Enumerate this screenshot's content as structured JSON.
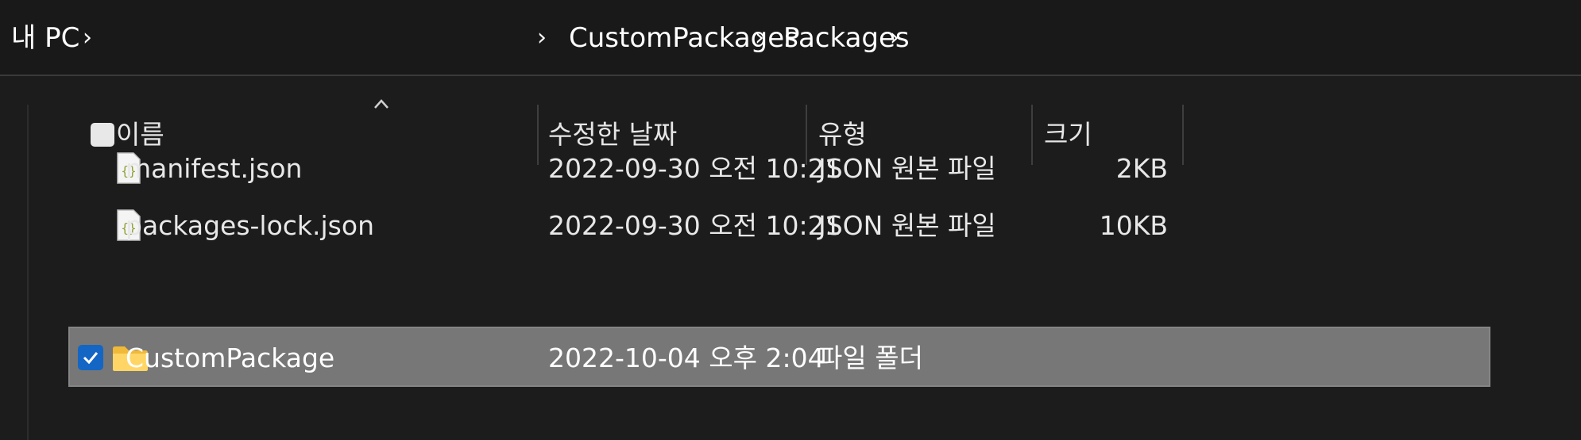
{
  "breadcrumb": {
    "root": "내 PC",
    "path": [
      "CustomPackages",
      "Packages"
    ]
  },
  "columns": {
    "name": "이름",
    "modified": "수정한 날짜",
    "type": "유형",
    "size": "크기"
  },
  "files": [
    {
      "name": "manifest.json",
      "modified": "2022-09-30 오전 10:21",
      "type": "JSON 원본 파일",
      "size": "2KB",
      "icon": "json-file-icon"
    },
    {
      "name": "packages-lock.json",
      "modified": "2022-09-30 오전 10:21",
      "type": "JSON 원본 파일",
      "size": "10KB",
      "icon": "json-file-icon"
    },
    {
      "name": "CustomPackage",
      "modified": "2022-10-04 오후 2:04",
      "type": "파일 폴더",
      "size": "",
      "icon": "folder-icon",
      "selected": true
    }
  ],
  "colors": {
    "background": "#1c1c1c",
    "selection": "#777777",
    "checkbox_accent": "#1466c4",
    "folder": "#f5c542"
  }
}
